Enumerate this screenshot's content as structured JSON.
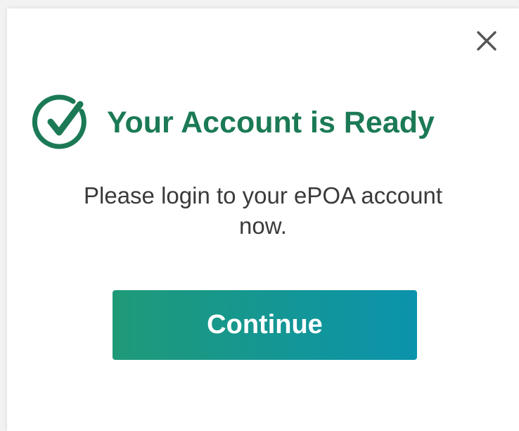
{
  "dialog": {
    "close_icon": "close-icon",
    "status_icon": "check-circle-icon",
    "title": "Your Account is Ready",
    "message_line1": "Please login to your ePOA account",
    "message_line2": "now.",
    "continue_label": "Continue"
  },
  "colors": {
    "title": "#1b7a55",
    "check_icon": "#1b7a55",
    "button_gradient_start": "#1f9a78",
    "button_gradient_end": "#0b93ac",
    "close_icon": "#555555"
  }
}
